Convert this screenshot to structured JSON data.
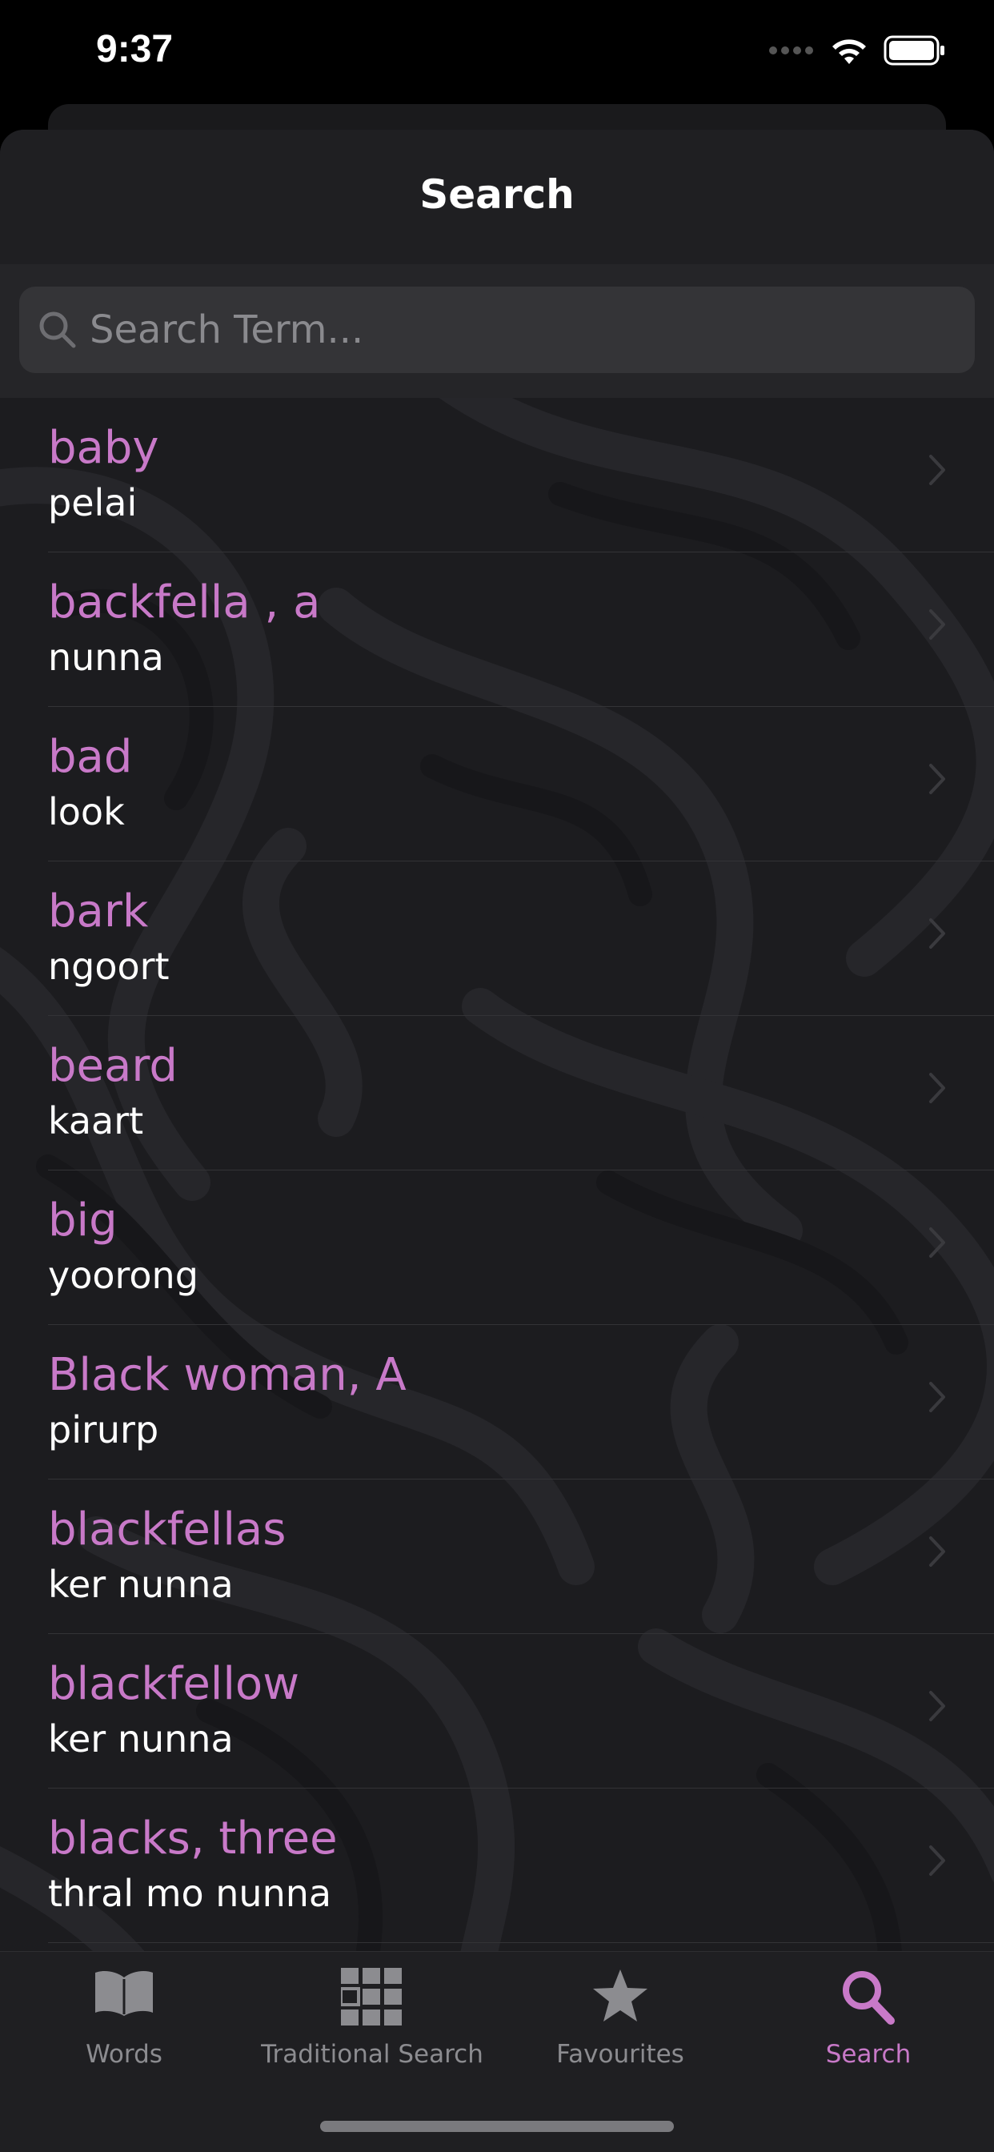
{
  "status_bar": {
    "time": "9:37"
  },
  "header": {
    "title": "Search"
  },
  "search": {
    "placeholder": "Search Term...",
    "value": ""
  },
  "results": [
    {
      "term": "baby",
      "translation": "pelai"
    },
    {
      "term": "backfella , a",
      "translation": "nunna"
    },
    {
      "term": "bad",
      "translation": "look"
    },
    {
      "term": "bark",
      "translation": "ngoort"
    },
    {
      "term": "beard",
      "translation": "kaart"
    },
    {
      "term": "big",
      "translation": "yoorong"
    },
    {
      "term": "Black woman, A",
      "translation": "pirurp"
    },
    {
      "term": "blackfellas",
      "translation": "ker nunna"
    },
    {
      "term": "blackfellow",
      "translation": "ker nunna"
    },
    {
      "term": "blacks, three",
      "translation": "thral mo nunna"
    }
  ],
  "tabs": [
    {
      "label": "Words",
      "icon": "book-icon",
      "active": false
    },
    {
      "label": "Traditional Search",
      "icon": "grid-icon",
      "active": false
    },
    {
      "label": "Favourites",
      "icon": "star-icon",
      "active": false
    },
    {
      "label": "Search",
      "icon": "search-icon",
      "active": true
    }
  ],
  "colors": {
    "accent": "#c879c8",
    "background": "#1c1c1f",
    "text": "#ffffff",
    "inactive_tab": "#8c8c90"
  }
}
